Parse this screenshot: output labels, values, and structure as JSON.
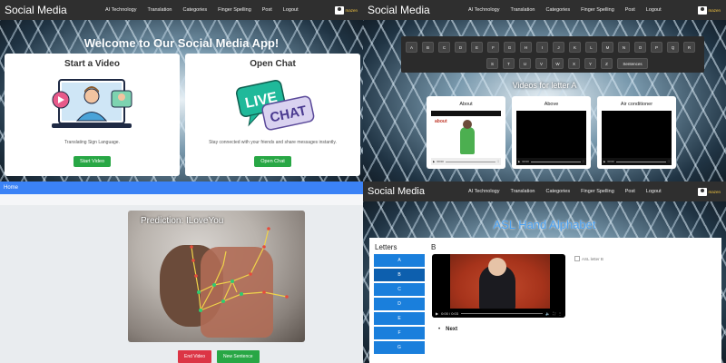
{
  "nav": {
    "brand": "Social Media",
    "links": [
      "AI Technology",
      "Translation",
      "Categories",
      "Finger Spelling",
      "Post",
      "Logout"
    ],
    "user": "mazen"
  },
  "q1": {
    "welcome": "Welcome to Our Social Media App!",
    "card1": {
      "title": "Start a Video",
      "desc": "Translating Sign Language.",
      "button": "Start Video",
      "icon": "video-call-illustration"
    },
    "card2": {
      "title": "Open Chat",
      "desc": "Stay connected with your friends and share messages instantly.",
      "button": "Open Chat",
      "badge_line1": "LIVE",
      "badge_line2": "CHAT"
    }
  },
  "q2": {
    "keys_row1": [
      "A",
      "B",
      "C",
      "D",
      "E",
      "F",
      "G",
      "H",
      "I",
      "J",
      "K",
      "L",
      "M",
      "N",
      "O",
      "P",
      "Q",
      "R"
    ],
    "keys_row2": [
      "S",
      "T",
      "U",
      "V",
      "W",
      "X",
      "Y",
      "Z",
      "Sentences"
    ],
    "videos_title": "Videos for letter A",
    "videos": [
      {
        "label": "About",
        "overlay": "about",
        "time": "00:00"
      },
      {
        "label": "Above",
        "time": "00:00"
      },
      {
        "label": "Air conditioner",
        "time": "00:00"
      }
    ]
  },
  "q3": {
    "home": "Home",
    "prediction": "Prediction: ILoveYou",
    "end_button": "End Video",
    "new_button": "New Sentence"
  },
  "q4": {
    "title": "ASL Hand Alphabet",
    "letters_header": "Letters",
    "letters": [
      "A",
      "B",
      "C",
      "D",
      "E",
      "F",
      "G"
    ],
    "active_letter": "B",
    "current": "B",
    "video_time": "0:00 / 0:03",
    "img_alt": "ASL letter B",
    "next_label": "Next",
    "next_bullet": "•"
  }
}
